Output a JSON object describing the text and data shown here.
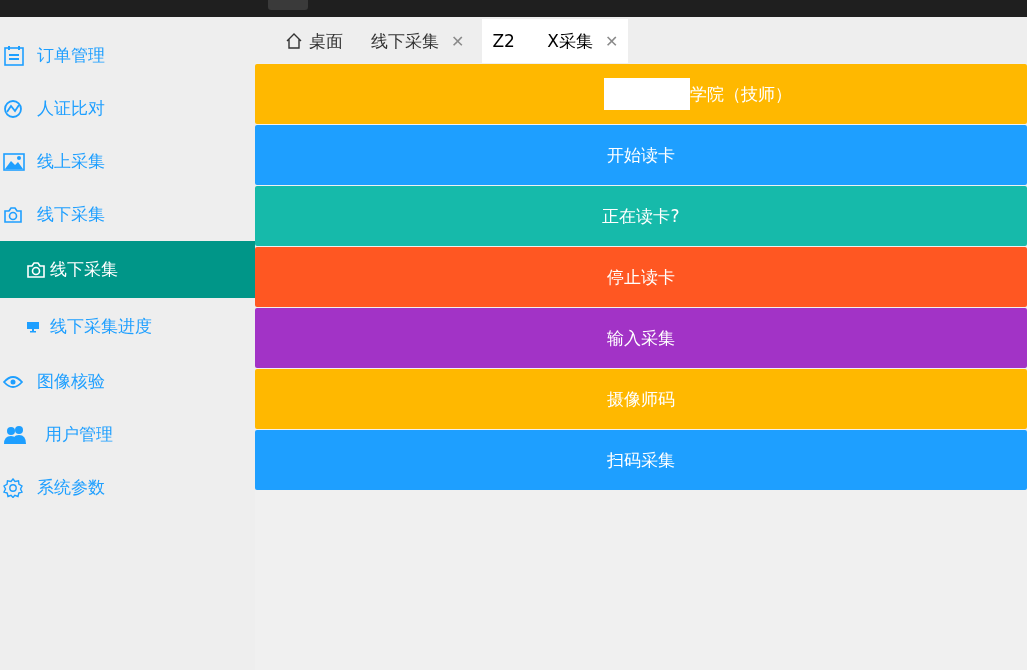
{
  "sidebar": {
    "items": [
      {
        "label": "订单管理",
        "selected": false
      },
      {
        "label": "人证比对",
        "selected": false
      },
      {
        "label": "线上采集",
        "selected": false
      },
      {
        "label": "线下采集",
        "selected": false,
        "children": [
          {
            "label": "线下采集",
            "selected": true
          },
          {
            "label": "线下采集进度",
            "selected": false
          }
        ]
      },
      {
        "label": "图像核验",
        "selected": false
      },
      {
        "label": "用户管理",
        "selected": false
      },
      {
        "label": "系统参数",
        "selected": false
      }
    ]
  },
  "tabs": [
    {
      "kind": "home",
      "label": "桌面",
      "selected": false
    },
    {
      "kind": "page",
      "label": "线下采集",
      "close": "✕",
      "selected": false
    },
    {
      "kind": "page",
      "label": "Z2      X采集",
      "close": "✕",
      "selected": true
    }
  ],
  "buttons": [
    {
      "kind": "redacted",
      "label": "学院（技师）",
      "color": "#ffb800"
    },
    {
      "kind": "plain",
      "label": "开始读卡",
      "color": "#1e9fff"
    },
    {
      "kind": "plain",
      "label": "正在读卡?",
      "color": "#16baaa"
    },
    {
      "kind": "plain",
      "label": "停止读卡",
      "color": "#ff5722"
    },
    {
      "kind": "plain",
      "label": "输入采集",
      "color": "#a233c6"
    },
    {
      "kind": "plain",
      "label": "摄像师码",
      "color": "#ffb800"
    },
    {
      "kind": "plain",
      "label": "扫码采集",
      "color": "#1e9fff"
    }
  ]
}
